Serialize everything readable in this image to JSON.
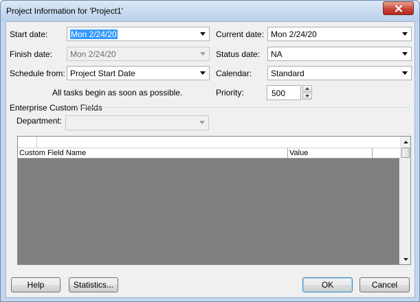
{
  "window": {
    "title": "Project Information for 'Project1'"
  },
  "fields": {
    "start_date_label": "Start date:",
    "start_date_value": "Mon 2/24/20",
    "finish_date_label": "Finish date:",
    "finish_date_value": "Mon 2/24/20",
    "schedule_from_label": "Schedule from:",
    "schedule_from_value": "Project Start Date",
    "schedule_note": "All tasks begin as soon as possible.",
    "current_date_label": "Current date:",
    "current_date_value": "Mon 2/24/20",
    "status_date_label": "Status date:",
    "status_date_value": "NA",
    "calendar_label": "Calendar:",
    "calendar_value": "Standard",
    "priority_label": "Priority:",
    "priority_value": "500"
  },
  "enterprise": {
    "group_label": "Enterprise Custom Fields",
    "department_label": "Department:",
    "department_value": "",
    "columns": [
      "Custom Field Name",
      "Value"
    ]
  },
  "buttons": {
    "help": "Help",
    "statistics": "Statistics...",
    "ok": "OK",
    "cancel": "Cancel"
  },
  "colors": {
    "selection": "#3399ff",
    "close_button": "#c7483a",
    "grid_empty": "#808080"
  },
  "icons": {
    "close": "close-icon",
    "dropdown": "chevron-down-icon",
    "spin_up": "spin-up-icon",
    "spin_down": "spin-down-icon"
  }
}
